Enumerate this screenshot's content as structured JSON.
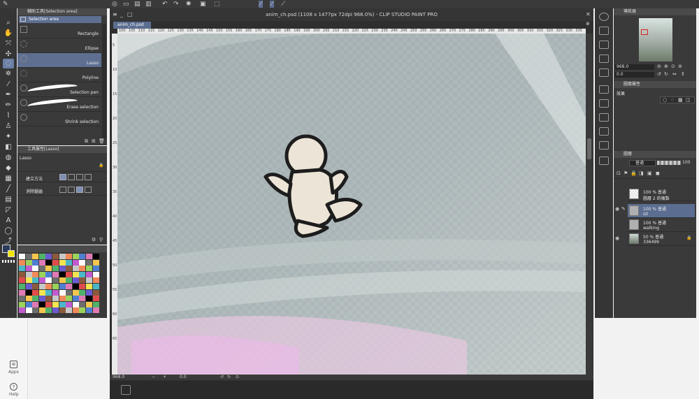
{
  "window": {
    "title": "anim_ch.psd (1108 x 1477px 72dpi 968.0%) - CLIP STUDIO PAINT PRO",
    "doc_tab": "anim_ch.psd"
  },
  "subtool_panel": {
    "header": "輔助工具[Selection area]",
    "group_label": "Selection area",
    "items": [
      {
        "label": "Rectangle",
        "selected": false
      },
      {
        "label": "Ellipse",
        "selected": false
      },
      {
        "label": "Lasso",
        "selected": true
      },
      {
        "label": "Polyline",
        "selected": false
      },
      {
        "label": "Selection pen",
        "selected": false
      },
      {
        "label": "Erase selection",
        "selected": false
      },
      {
        "label": "Shrink selection",
        "selected": false
      }
    ]
  },
  "tool_property": {
    "header": "工具屬性[Lasso]",
    "tool_name": "Lasso",
    "rows": [
      {
        "label": "建立方法"
      },
      {
        "label": "消除鋸齒"
      }
    ]
  },
  "ruler": {
    "top_ticks": [
      "100",
      "105",
      "110",
      "115",
      "120",
      "125",
      "130",
      "135",
      "140",
      "145",
      "150",
      "155",
      "160",
      "165",
      "170",
      "175",
      "180",
      "185",
      "190",
      "195",
      "200",
      "205",
      "210",
      "215",
      "220",
      "225",
      "230",
      "235",
      "240",
      "245",
      "250",
      "255",
      "260",
      "265",
      "270",
      "275",
      "280",
      "285",
      "290",
      "295",
      "300",
      "305",
      "310",
      "315",
      "320",
      "325",
      "330",
      "335"
    ],
    "left_ticks": [
      "5",
      "10",
      "15",
      "20",
      "25",
      "30",
      "35",
      "40",
      "45",
      "50",
      "55",
      "60",
      "65"
    ]
  },
  "status": {
    "zoom": "968.0",
    "angle": "0.0"
  },
  "navigator": {
    "header": "導航器",
    "zoom": "968.0",
    "rotation": "0.0"
  },
  "layer_property": {
    "header": "圖層屬性",
    "effect_label": "效果"
  },
  "layer_panel": {
    "header": "圖層",
    "blend_mode": "普通",
    "opacity": "100",
    "layers": [
      {
        "line1": "100 % 普通",
        "line2": "圖層 2 的複製",
        "selected": false
      },
      {
        "line1": "100 % 普通",
        "line2": "sit",
        "selected": true
      },
      {
        "line1": "100 % 普通",
        "line2": "walking",
        "selected": false
      },
      {
        "line1": "50 % 普通",
        "line2": "336499",
        "selected": false
      }
    ]
  },
  "os_sidebar": {
    "apps_label": "Apps",
    "help_label": "Help"
  },
  "colors": {
    "selection_blue": "#5e6f92",
    "main_color": "#2a3a5a",
    "sub_color": "#f2e600"
  }
}
